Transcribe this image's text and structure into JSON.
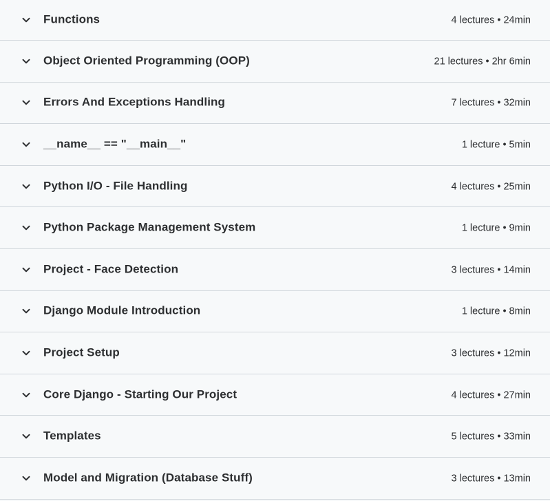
{
  "sections": [
    {
      "title": "Functions",
      "meta": "4 lectures • 24min"
    },
    {
      "title": "Object Oriented Programming (OOP)",
      "meta": "21 lectures • 2hr 6min"
    },
    {
      "title": "Errors And Exceptions Handling",
      "meta": "7 lectures • 32min"
    },
    {
      "title": "__name__ == \"__main__\"",
      "meta": "1 lecture • 5min"
    },
    {
      "title": "Python I/O - File Handling",
      "meta": "4 lectures • 25min"
    },
    {
      "title": "Python Package Management System",
      "meta": "1 lecture • 9min"
    },
    {
      "title": "Project - Face Detection",
      "meta": "3 lectures • 14min"
    },
    {
      "title": "Django Module Introduction",
      "meta": "1 lecture • 8min"
    },
    {
      "title": "Project Setup",
      "meta": "3 lectures • 12min"
    },
    {
      "title": "Core Django - Starting Our Project",
      "meta": "4 lectures • 27min"
    },
    {
      "title": "Templates",
      "meta": "5 lectures • 33min"
    },
    {
      "title": "Model and Migration (Database Stuff)",
      "meta": "3 lectures • 13min"
    }
  ],
  "icons": {
    "expand": "chevron-down-icon"
  },
  "colors": {
    "background": "#f7f9fa",
    "divider": "#d1d7dc",
    "text": "#2d2f31"
  }
}
